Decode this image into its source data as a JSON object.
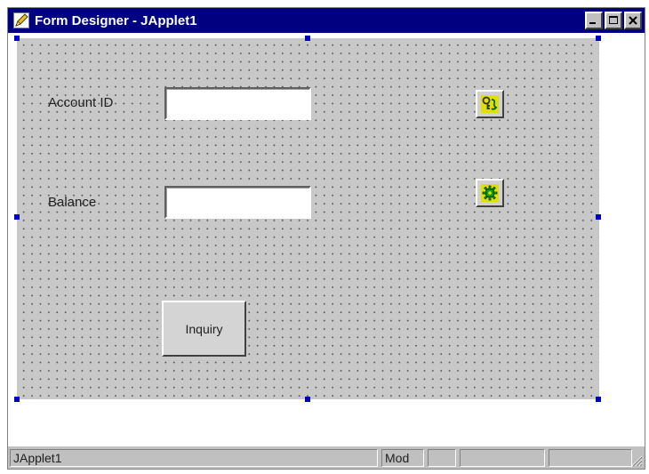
{
  "window": {
    "title": "Form Designer - JApplet1",
    "controls": {
      "minimize": "_",
      "maximize": "□",
      "close": "✕"
    }
  },
  "form": {
    "account_label": "Account ID",
    "balance_label": "Balance",
    "account_field_value": "",
    "balance_field_value": "",
    "inquiry_button": "Inquiry"
  },
  "beans": [
    {
      "icon": "key-bean-icon"
    },
    {
      "icon": "gear-bean-icon"
    }
  ],
  "status": {
    "name": "JApplet1",
    "mode": "Mod",
    "pane3": "",
    "pane4": "",
    "pane5": "",
    "pane6": ""
  },
  "colors": {
    "titlebar": "#000080",
    "design_grid": "#c8c8c8",
    "selection_handle": "#0000c0"
  }
}
